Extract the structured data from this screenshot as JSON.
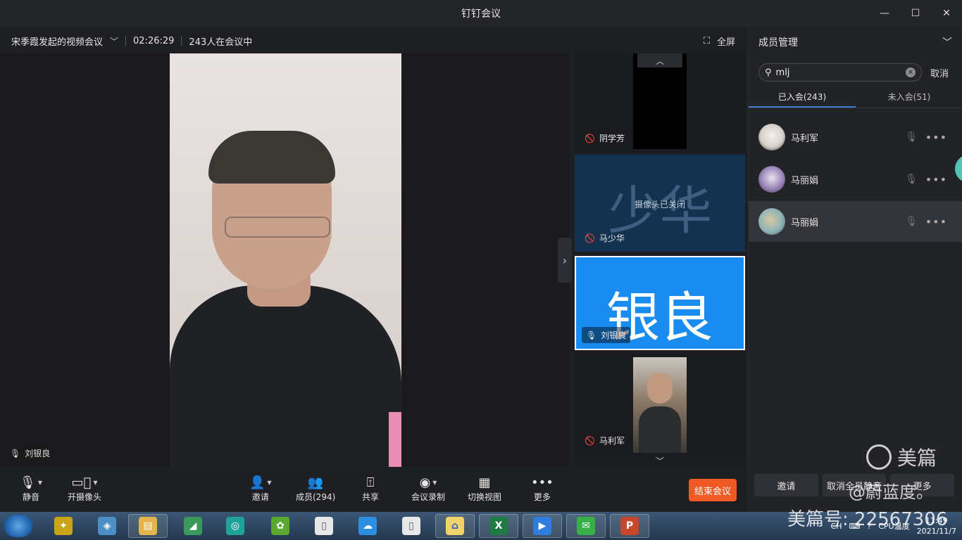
{
  "window": {
    "title": "钉钉会议"
  },
  "meeting": {
    "title": "宋季霞发起的视频会议",
    "duration": "02:26:29",
    "attendees": "243人在会议中",
    "fullscreen_label": "全屏"
  },
  "stage": {
    "speaker_name": "刘银良"
  },
  "thumbnails": [
    {
      "name": "阴学芳",
      "muted": true
    },
    {
      "name": "马少华",
      "muted": true,
      "avatar_text": "少华",
      "camera_off_text": "摄像头已关闭"
    },
    {
      "name": "刘银良",
      "muted": false,
      "avatar_text": "银良",
      "active": true
    },
    {
      "name": "马利军",
      "muted": true
    }
  ],
  "panel": {
    "title": "成员管理",
    "search_value": "mlj",
    "cancel_label": "取消",
    "tabs": [
      {
        "label": "已入会(243)"
      },
      {
        "label": "未入会(51)"
      }
    ],
    "members": [
      {
        "name": "马利军"
      },
      {
        "name": "马丽娟"
      },
      {
        "name": "马丽娟"
      }
    ],
    "footer": {
      "invite": "邀请",
      "unmute_all": "取消全员静音",
      "more": "更多"
    }
  },
  "toolbar": {
    "mute": "静音",
    "camera": "开摄像头",
    "invite": "邀请",
    "members": "成员(294)",
    "share": "共享",
    "record": "会议录制",
    "switch_view": "切换视图",
    "more": "更多",
    "end": "结束会议"
  },
  "taskbar": {
    "tray_lang": "CH",
    "cpu_label": "CPU温度",
    "time": "11:49",
    "date": "2021/11/7"
  },
  "watermark": {
    "brand": "美篇",
    "author": "@蔚蓝度。",
    "id": "美篇号: 22567306"
  },
  "colors": {
    "accent": "#1a8cf0",
    "end_button": "#f05a24",
    "cam_off_tile": "#13324f"
  }
}
